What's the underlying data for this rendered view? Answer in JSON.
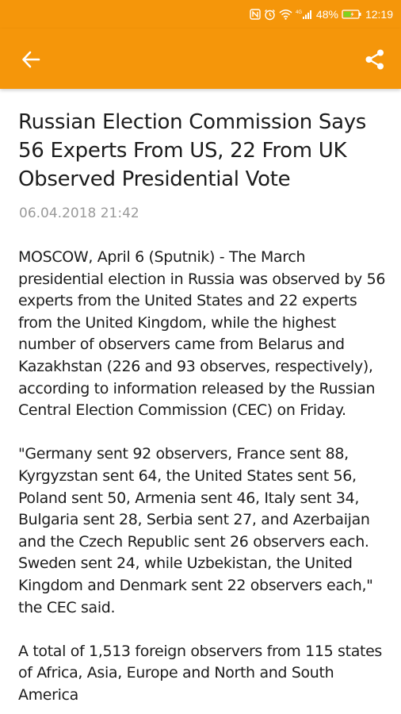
{
  "status_bar": {
    "battery_percent": "48%",
    "time": "12:19",
    "network_badge": "4G",
    "icons": [
      "nfc-icon",
      "alarm-icon",
      "wifi-icon",
      "signal-icon",
      "battery-icon"
    ]
  },
  "app_bar": {
    "background": "#f5960a",
    "back_icon": "arrow-left-icon",
    "share_icon": "share-icon"
  },
  "article": {
    "title": "Russian Election Commission Says 56 Experts From US, 22 From UK Observed Presidential Vote",
    "date": "06.04.2018 21:42",
    "paragraphs": [
      "MOSCOW, April 6 (Sputnik) - The March presidential election in Russia was observed by 56 experts from the United States and 22 experts from the United Kingdom, while the highest number of observers came from Belarus and Kazakhstan (226 and 93 observes, respectively), according to information released by the Russian Central Election Commission (CEC) on Friday.",
      "\"Germany sent 92 observers, France sent 88, Kyrgyzstan sent 64, the United States sent 56, Poland sent 50, Armenia sent 46, Italy sent 34, Bulgaria sent 28, Serbia sent 27, and Azerbaijan and the Czech Republic sent 26 observers each. Sweden sent 24, while Uzbekistan, the United Kingdom and Denmark sent 22 observers each,\" the CEC said.",
      "A total of 1,513 foreign observers from 115 states of Africa, Asia, Europe and North and South America"
    ]
  }
}
